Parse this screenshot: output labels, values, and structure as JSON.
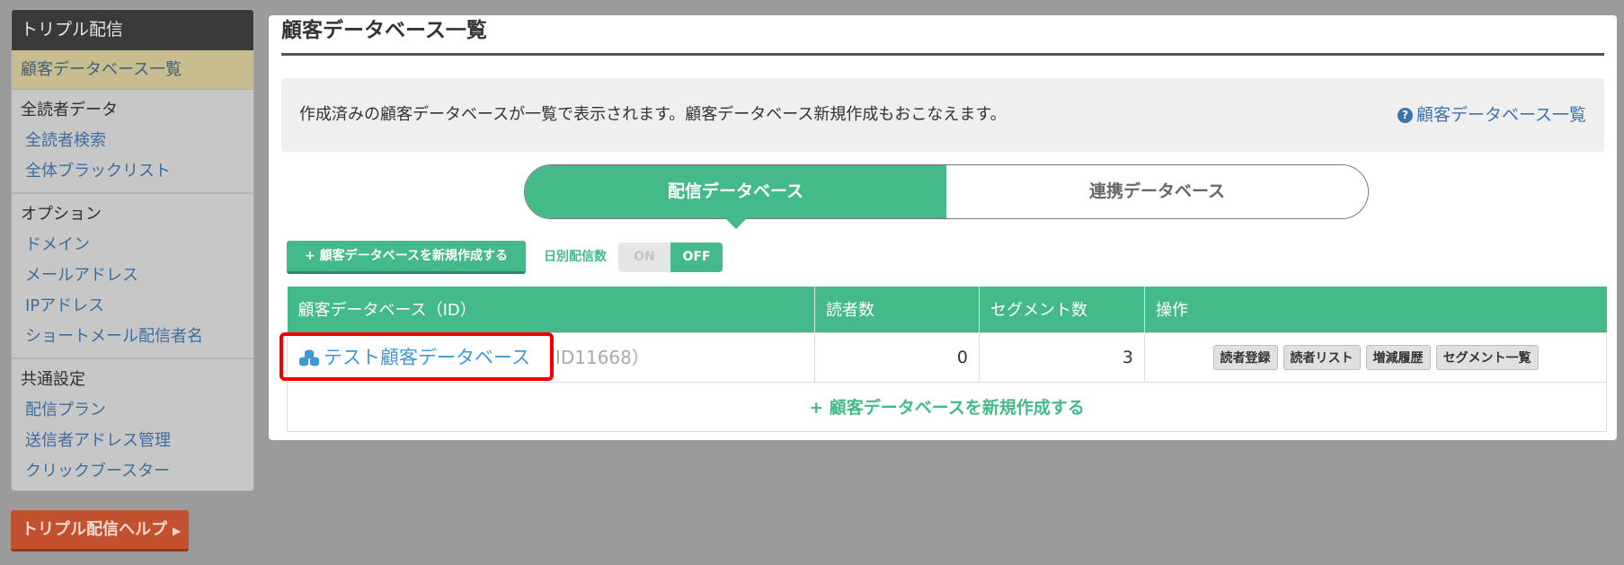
{
  "sidebar": {
    "title": "トリプル配信",
    "active_item": "顧客データベース一覧",
    "sections": [
      {
        "heading": "全読者データ",
        "links": [
          "全読者検索",
          "全体ブラックリスト"
        ]
      },
      {
        "heading": "オプション",
        "links": [
          "ドメイン",
          "メールアドレス",
          "IPアドレス",
          "ショートメール配信者名"
        ]
      },
      {
        "heading": "共通設定",
        "links": [
          "配信プラン",
          "送信者アドレス管理",
          "クリックブースター"
        ]
      }
    ]
  },
  "help_button": {
    "label": "トリプル配信ヘルプ",
    "arrow": "▶"
  },
  "main": {
    "title": "顧客データベース一覧",
    "info_text": "作成済みの顧客データベースが一覧で表示されます。顧客データベース新規作成もおこなえます。",
    "info_link": "顧客データベース一覧",
    "tabs": [
      {
        "label": "配信データベース",
        "active": true
      },
      {
        "label": "連携データベース",
        "active": false
      }
    ],
    "create_button": "+ 顧客データベースを新規作成する",
    "daily_label": "日別配信数",
    "toggle": {
      "on": "ON",
      "off": "OFF",
      "state": "OFF"
    },
    "table": {
      "headers": [
        "顧客データベース（ID）",
        "読者数",
        "セグメント数",
        "操作"
      ],
      "rows": [
        {
          "name": "テスト顧客データベース",
          "id": "（ID11668）",
          "readers": "0",
          "segments": "3",
          "ops": [
            "読者登録",
            "読者リスト",
            "増減履歴",
            "セグメント一覧"
          ]
        }
      ],
      "create_row": "+ 顧客データベースを新規作成する"
    }
  },
  "colors": {
    "accent": "#44b989",
    "link": "#3c9ad6",
    "help": "#c3502f",
    "highlight": "#ec0000"
  }
}
